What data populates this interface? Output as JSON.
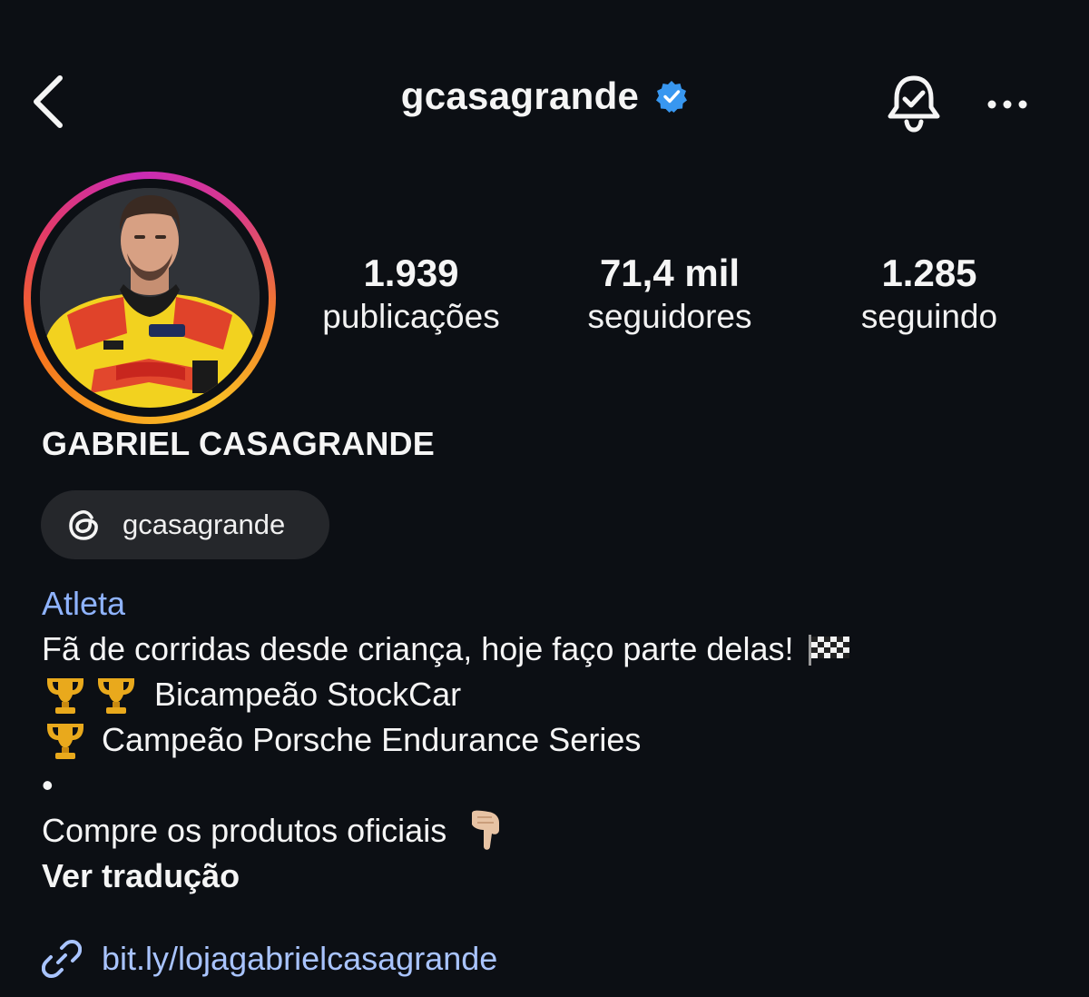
{
  "header": {
    "username": "gcasagrande",
    "verified": true,
    "icons": {
      "back": "back-chevron-icon",
      "verified": "verified-badge-icon",
      "bell": "notification-bell-icon",
      "more": "more-options-icon"
    }
  },
  "stats": [
    {
      "value": "1.939",
      "label": "publicações"
    },
    {
      "value": "71,4 mil",
      "label": "seguidores"
    },
    {
      "value": "1.285",
      "label": "seguindo"
    }
  ],
  "profile": {
    "full_name": "GABRIEL CASAGRANDE",
    "threads_handle": "gcasagrande",
    "category": "Atleta",
    "bio_line_1": "Fã de corridas desde criança, hoje faço parte delas!",
    "bio_line_2": "Bicampeão StockCar",
    "bio_line_3": "Campeão Porsche Endurance Series",
    "bio_line_4": "•",
    "bio_line_5": "Compre os produtos oficiais",
    "see_translation": "Ver tradução",
    "link": "bit.ly/lojagabrielcasagrande"
  },
  "colors": {
    "background": "#0c0f14",
    "verified_blue": "#3897f0",
    "category_blue": "#8fb3ff",
    "link_blue": "#a9c4ff",
    "chip_bg": "#25272b"
  }
}
